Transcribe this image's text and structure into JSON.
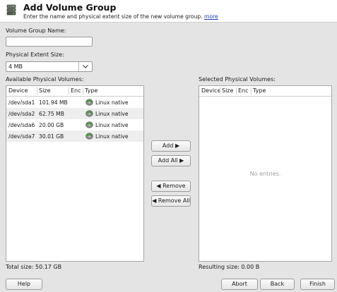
{
  "header": {
    "title": "Add Volume Group",
    "subtitle": "Enter the name and physical extent size of the new volume group.",
    "more_link": "more"
  },
  "form": {
    "vg_name_label": "Volume Group Name:",
    "vg_name_value": "",
    "extent_label": "Physical Extent Size:",
    "extent_value": "4 MB"
  },
  "available": {
    "label": "Available Physical Volumes:",
    "columns": [
      "Device",
      "Size",
      "Enc",
      "Type"
    ],
    "rows": [
      {
        "device": "/dev/sda1",
        "size": "101.94 MB",
        "enc": "",
        "type": "Linux native"
      },
      {
        "device": "/dev/sda2",
        "size": "62.75 MB",
        "enc": "",
        "type": "Linux native"
      },
      {
        "device": "/dev/sda6",
        "size": "20.00 GB",
        "enc": "",
        "type": "Linux native"
      },
      {
        "device": "/dev/sda7",
        "size": "30.01 GB",
        "enc": "",
        "type": "Linux native"
      }
    ],
    "total_label": "Total size: 50.17 GB"
  },
  "selected": {
    "label": "Selected Physical Volumes:",
    "columns": [
      "Device",
      "Size",
      "Enc",
      "Type"
    ],
    "empty_text": "No entries.",
    "resulting_label": "Resulting size: 0.00 B"
  },
  "move_buttons": {
    "add": "Add ▶",
    "add_all": "Add All ▶",
    "remove": "◀ Remove",
    "remove_all": "◀ Remove All"
  },
  "footer": {
    "help": "Help",
    "abort": "Abort",
    "back": "Back",
    "finish": "Finish"
  }
}
